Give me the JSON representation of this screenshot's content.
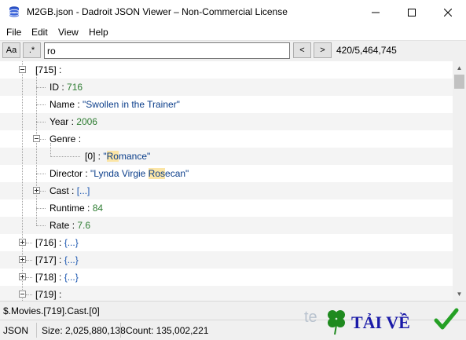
{
  "window": {
    "title": "M2GB.json - Dadroit JSON Viewer – Non-Commercial License"
  },
  "menu": [
    "File",
    "Edit",
    "View",
    "Help"
  ],
  "toolbar": {
    "case_label": "Aa",
    "regex_label": ".*",
    "search_value": "ro",
    "prev_label": "<",
    "next_label": ">",
    "match_count": "420/5,464,745"
  },
  "tree": {
    "node_715": "[715]",
    "sep": " :",
    "id_key": "ID",
    "id_value": "716",
    "name_key": "Name",
    "name_value": "\"Swollen in the Trainer\"",
    "year_key": "Year",
    "year_value": "2006",
    "genre_key": "Genre",
    "genre_item_key": "[0]",
    "genre_q1": "\"",
    "genre_hl": "Ro",
    "genre_rest": "mance\"",
    "director_key": "Director",
    "director_pre": "\"Lynda Virgie ",
    "director_hl": "Ros",
    "director_post": "ecan\"",
    "cast_key": "Cast",
    "cast_value": "[...]",
    "runtime_key": "Runtime",
    "runtime_value": "84",
    "rate_key": "Rate",
    "rate_value": "7.6",
    "node_716": "[716]",
    "node_717": "[717]",
    "node_718": "[718]",
    "node_719": "[719]",
    "collapsed_obj": "{...}"
  },
  "path": "$.Movies.[719].Cast.[0]",
  "status": {
    "format": "JSON",
    "size": "Size: 2,025,880,138",
    "count": "Count: 135,002,221"
  },
  "watermark": {
    "text": "TẢI VỀ"
  }
}
